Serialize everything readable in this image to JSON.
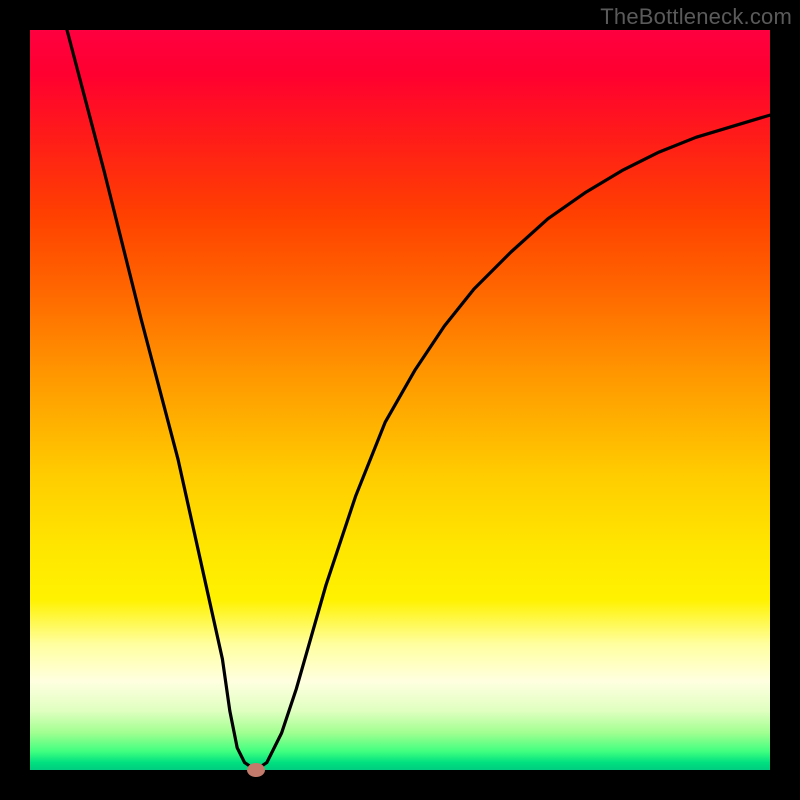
{
  "watermark": "TheBottleneck.com",
  "chart_data": {
    "type": "line",
    "title": "",
    "xlabel": "",
    "ylabel": "",
    "xlim": [
      0,
      100
    ],
    "ylim": [
      0,
      100
    ],
    "series": [
      {
        "name": "bottleneck-curve",
        "x": [
          5,
          10,
          15,
          20,
          24,
          26,
          27,
          28,
          29,
          30.5,
          32,
          34,
          36,
          38,
          40,
          44,
          48,
          52,
          56,
          60,
          65,
          70,
          75,
          80,
          85,
          90,
          95,
          100
        ],
        "values": [
          100,
          81,
          61,
          42,
          24,
          15,
          8,
          3,
          1,
          0,
          1,
          5,
          11,
          18,
          25,
          37,
          47,
          54,
          60,
          65,
          70,
          74.5,
          78,
          81,
          83.5,
          85.5,
          87,
          88.5
        ]
      }
    ],
    "marker": {
      "x": 30.5,
      "y": 0
    },
    "gradient_stops": [
      {
        "pos": 0,
        "color": "#ff0040"
      },
      {
        "pos": 50,
        "color": "#ff9900"
      },
      {
        "pos": 78,
        "color": "#ffff80"
      },
      {
        "pos": 100,
        "color": "#00cc80"
      }
    ]
  }
}
